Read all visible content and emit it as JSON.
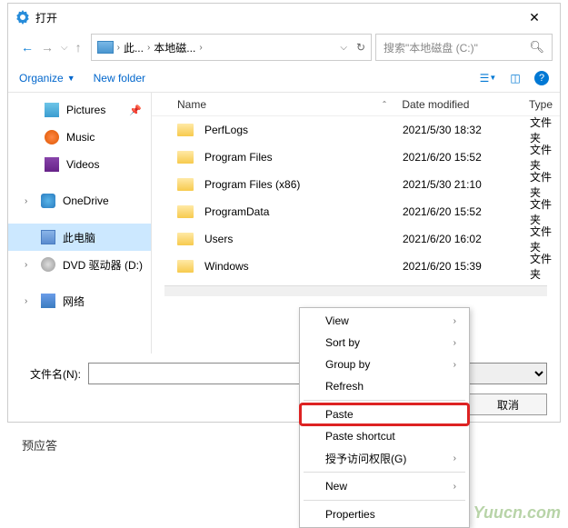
{
  "title": "打开",
  "breadcrumb": {
    "p1": "此...",
    "p2": "本地磁..."
  },
  "search": {
    "placeholder": "搜索\"本地磁盘 (C:)\""
  },
  "toolbar": {
    "organize": "Organize",
    "newfolder": "New folder"
  },
  "columns": {
    "name": "Name",
    "date": "Date modified",
    "type": "Type"
  },
  "sidebar": {
    "pictures": "Pictures",
    "music": "Music",
    "videos": "Videos",
    "onedrive": "OneDrive",
    "thispc": "此电脑",
    "dvd": "DVD 驱动器 (D:)",
    "network": "网络"
  },
  "files": [
    {
      "name": "PerfLogs",
      "date": "2021/5/30 18:32",
      "type": "文件夹"
    },
    {
      "name": "Program Files",
      "date": "2021/6/20 15:52",
      "type": "文件夹"
    },
    {
      "name": "Program Files (x86)",
      "date": "2021/5/30 21:10",
      "type": "文件夹"
    },
    {
      "name": "ProgramData",
      "date": "2021/6/20 15:52",
      "type": "文件夹"
    },
    {
      "name": "Users",
      "date": "2021/6/20 16:02",
      "type": "文件夹"
    },
    {
      "name": "Windows",
      "date": "2021/6/20 15:39",
      "type": "文件夹"
    }
  ],
  "filename_label": "文件名(N):",
  "buttons": {
    "cancel": "取消"
  },
  "context_menu": {
    "view": "View",
    "sortby": "Sort by",
    "groupby": "Group by",
    "refresh": "Refresh",
    "paste": "Paste",
    "paste_shortcut": "Paste shortcut",
    "grant_access": "授予访问权限(G)",
    "new": "New",
    "properties": "Properties"
  },
  "behind_text": "预应答",
  "watermark": "Yuucn.com"
}
